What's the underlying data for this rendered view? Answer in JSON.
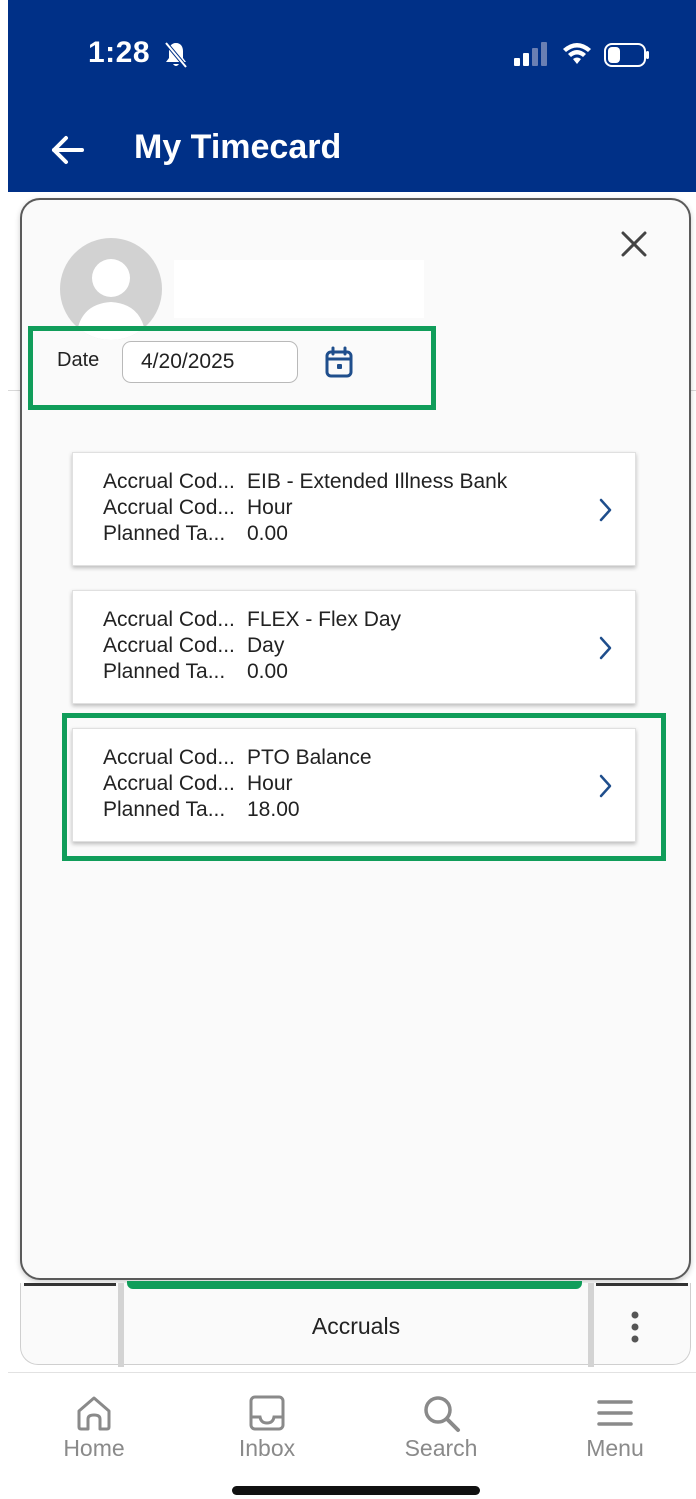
{
  "status_bar": {
    "time": "1:28"
  },
  "header": {
    "title": "My Timecard"
  },
  "date_filter": {
    "label": "Date",
    "value": "4/20/2025"
  },
  "accruals": [
    {
      "rows": [
        {
          "label": "Accrual Cod...",
          "value": "EIB - Extended Illness Bank"
        },
        {
          "label": "Accrual Cod...",
          "value": "Hour"
        },
        {
          "label": "Planned Ta...",
          "value": "0.00"
        }
      ]
    },
    {
      "rows": [
        {
          "label": "Accrual Cod...",
          "value": "FLEX - Flex Day"
        },
        {
          "label": "Accrual Cod...",
          "value": "Day"
        },
        {
          "label": "Planned Ta...",
          "value": "0.00"
        }
      ]
    },
    {
      "rows": [
        {
          "label": "Accrual Cod...",
          "value": "PTO Balance"
        },
        {
          "label": "Accrual Cod...",
          "value": "Hour"
        },
        {
          "label": "Planned Ta...",
          "value": "18.00"
        }
      ]
    }
  ],
  "tabs": {
    "active_label": "Accruals"
  },
  "bottom_nav": [
    {
      "label": "Home",
      "icon": "home-icon"
    },
    {
      "label": "Inbox",
      "icon": "inbox-icon"
    },
    {
      "label": "Search",
      "icon": "search-icon"
    },
    {
      "label": "Menu",
      "icon": "menu-icon"
    }
  ],
  "colors": {
    "header_bg": "#003087",
    "highlight": "#109d5a",
    "accent_icon": "#1f4e8c",
    "nav_inactive": "#8a8a8a"
  }
}
